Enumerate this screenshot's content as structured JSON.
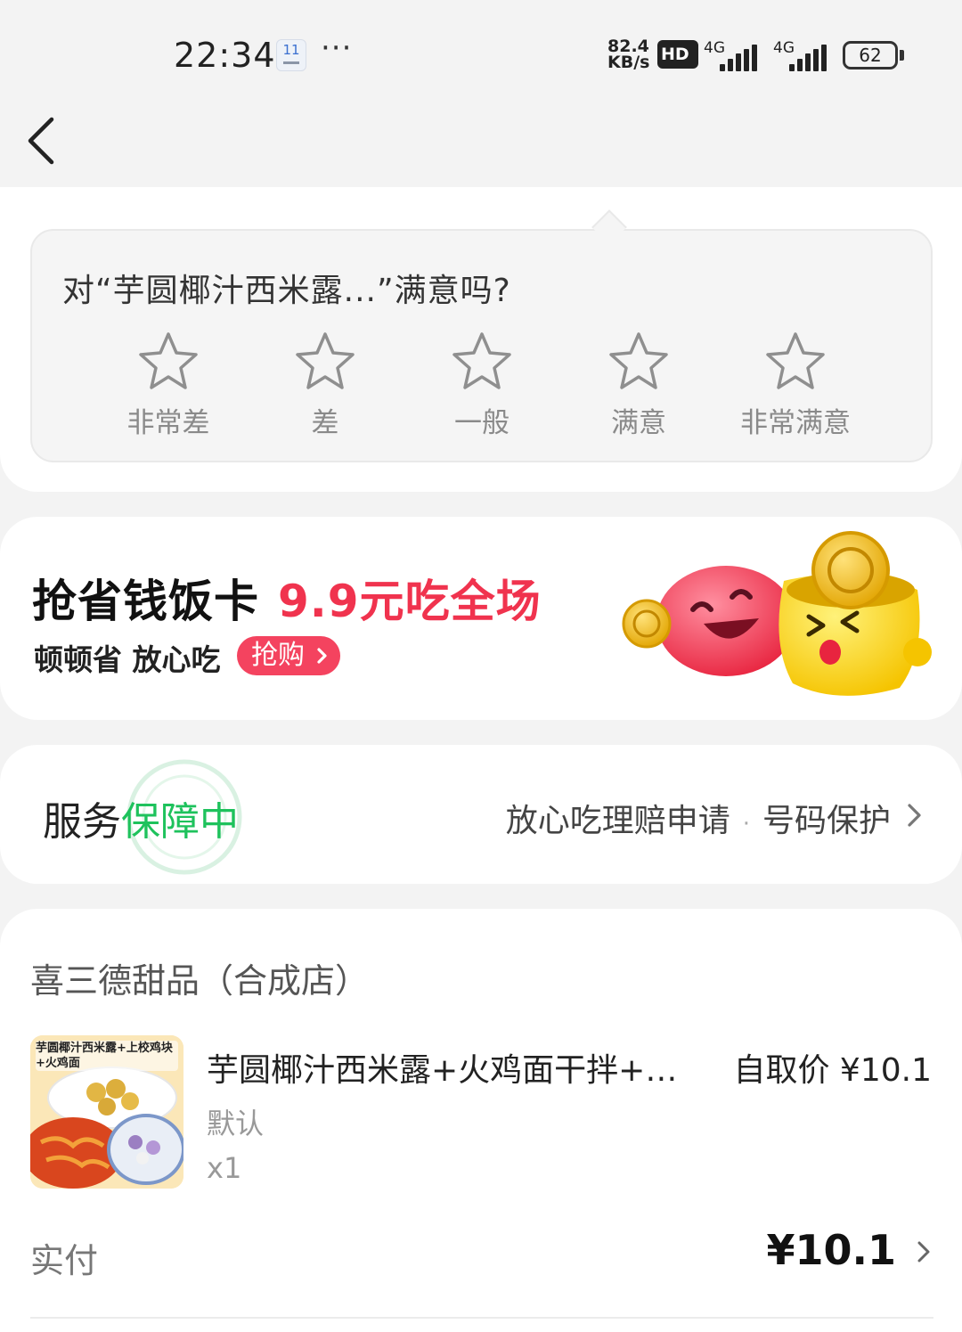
{
  "status_bar": {
    "time": "22:34",
    "calendar_day": "11",
    "more": "···",
    "speed": "82.4",
    "speed_unit": "KB/s",
    "hd": "HD",
    "net1": "4G",
    "net2": "4G",
    "battery": "62"
  },
  "rating": {
    "question": "对“芋圆椰汁西米露...”满意吗?",
    "options": [
      "非常差",
      "差",
      "一般",
      "满意",
      "非常满意"
    ]
  },
  "promo": {
    "title": "抢省钱饭卡",
    "highlight": "9.9元吃全场",
    "subtitle": "顿顿省 放心吃",
    "button": "抢购"
  },
  "service": {
    "title_prefix": "服务",
    "title_highlight": "保障中",
    "link1": "放心吃理赔申请",
    "separator": "·",
    "link2": "号码保护"
  },
  "order": {
    "shop_name": "喜三德甜品（合成店）",
    "item": {
      "thumb_caption": "芋圆椰汁西米露+上校鸡块+火鸡面",
      "name": "芋圆椰汁西米露+火鸡面干拌+…",
      "price": "自取价 ¥10.1",
      "spec": "默认",
      "qty": "x1"
    },
    "paid_label": "实付",
    "paid_amount": "¥10.1"
  },
  "colors": {
    "accent_red": "#f0334e",
    "accent_green": "#1ec25c"
  }
}
